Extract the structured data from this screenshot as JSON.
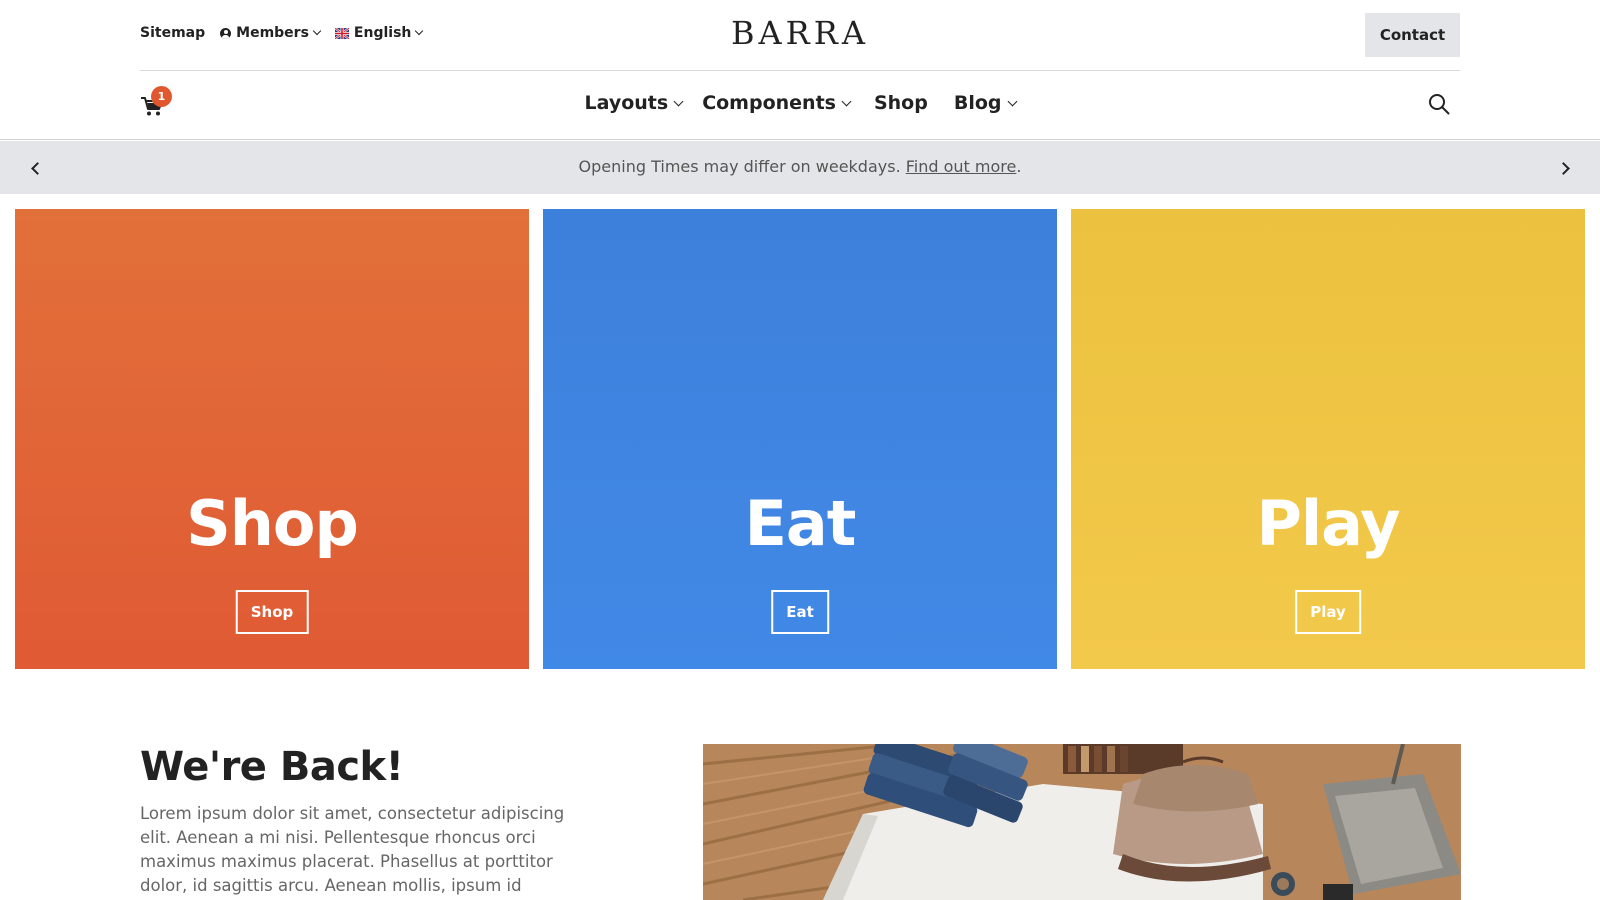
{
  "topbar": {
    "sitemap": "Sitemap",
    "members": "Members",
    "language": "English",
    "logo": "BARRA",
    "contact": "Contact"
  },
  "nav": {
    "cart_count": "1",
    "items": [
      {
        "label": "Layouts"
      },
      {
        "label": "Components"
      },
      {
        "label": "Shop"
      },
      {
        "label": "Blog"
      }
    ]
  },
  "announcement": {
    "text": "Opening Times may differ on weekdays.",
    "link": "Find out more",
    "trailing": "."
  },
  "tiles": [
    {
      "title": "Shop",
      "button": "Shop",
      "color_top": "#e2703a",
      "color_bottom": "#e05a34"
    },
    {
      "title": "Eat",
      "button": "Eat",
      "color_top": "#3d80db",
      "color_bottom": "#4189e6"
    },
    {
      "title": "Play",
      "button": "Play",
      "color_top": "#ecc13f",
      "color_bottom": "#f3c94b"
    }
  ],
  "intro": {
    "title": "We're Back!",
    "body": "Lorem ipsum dolor sit amet, consectetur adipiscing elit. Aenean a mi nisi. Pellentesque rhoncus orci maximus maximus placerat. Phasellus at porttitor dolor, id sagittis arcu. Aenean mollis, ipsum id"
  }
}
